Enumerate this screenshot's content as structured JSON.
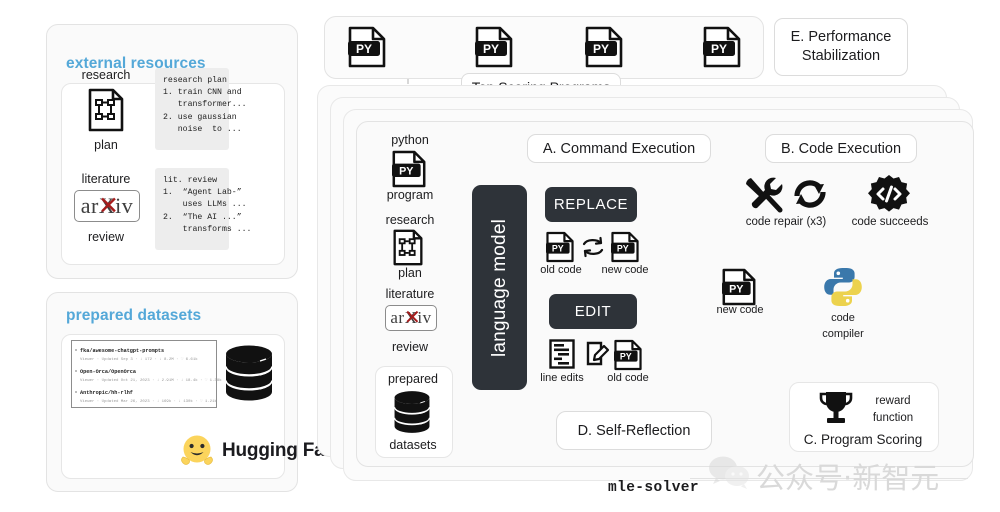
{
  "external_resources": {
    "title": "external resources",
    "research_plan": {
      "top_label": "research",
      "bottom_label": "plan",
      "icon": "flowchart-document-icon"
    },
    "research_plan_code": "research plan\n1. train CNN and\n   transformer...\n2. use gaussian\n   noise  to ...",
    "literature_review": {
      "top_label": "literature",
      "bottom_label": "review",
      "icon": "arxiv-logo",
      "logo_text": "arXiv"
    },
    "literature_code": "lit. review\n1.  “Agent Lab-”\n    uses LLMs ...\n2.  “The AI ...”\n    transforms ..."
  },
  "prepared_datasets": {
    "title": "prepared datasets",
    "database_icon": "database-stack-icon",
    "huggingface": {
      "wordmark": "Hugging Face",
      "icon": "hugging-face-emoji"
    },
    "rows": [
      {
        "name": "fka/awesome-chatgpt-prompts",
        "meta": "Viewer · Updated Sep 3 · ↓ 172 · ↓ 8.2M · ♡ 6.61k"
      },
      {
        "name": "Open-Orca/OpenOrca",
        "meta": "Viewer · Updated Oct 21, 2023 · ↓ 2.91M · ↓ 18.4k · ♡ 1.38k"
      },
      {
        "name": "Anthropic/hh-rlhf",
        "meta": "Viewer · Updated Mar 26, 2023 · ↓ 169k · ↓ 130k · ♡ 1.21k"
      }
    ]
  },
  "top_banner": {
    "caption": "Top Scoring Programs",
    "program_count": 4,
    "program_icon": "python-file-icon"
  },
  "performance_stabilization": {
    "line1": "E. Performance",
    "line2": "Stabilization"
  },
  "solver": {
    "caption": "mle-solver",
    "language_model": "language model",
    "inputs": [
      {
        "top": "python",
        "bottom": "program",
        "icon": "python-file-icon"
      },
      {
        "top": "research",
        "bottom": "plan",
        "icon": "flowchart-document-icon"
      },
      {
        "top": "literature",
        "bottom": "review",
        "icon": "arxiv-logo"
      },
      {
        "top": "prepared",
        "bottom": "datasets",
        "icon": "database-stack-icon"
      }
    ],
    "section_a": {
      "title": "A. Command Execution",
      "replace_label": "REPLACE",
      "replace_icons": [
        {
          "label": "old code",
          "icon": "python-file-icon"
        },
        {
          "label": "",
          "icon": "swap-arrows-icon"
        },
        {
          "label": "new code",
          "icon": "python-file-icon"
        }
      ],
      "edit_label": "EDIT",
      "edit_icons": [
        {
          "label": "line edits",
          "icon": "diff-lines-icon"
        },
        {
          "label": "",
          "icon": "pencil-square-icon"
        },
        {
          "label": "old code",
          "icon": "python-file-icon"
        }
      ]
    },
    "section_b": {
      "title": "B. Code Execution",
      "code_repair": {
        "label": "code repair (x3)",
        "icons": [
          "wrench-screwdriver-icon",
          "refresh-cycle-icon"
        ]
      },
      "code_succeeds": {
        "label": "code succeeds",
        "icon": "code-gear-icon"
      },
      "new_code": {
        "label": "new code",
        "icon": "python-file-icon"
      },
      "compiler": {
        "line1": "code",
        "line2": "compiler",
        "icon": "python-logo-icon"
      }
    },
    "section_c": {
      "title": "C. Program Scoring",
      "reward_line1": "reward",
      "reward_line2": "function",
      "icon": "trophy-icon"
    },
    "section_d": {
      "title": "D. Self-Reflection"
    }
  },
  "watermark": {
    "text": "公众号·新智元",
    "icon": "wechat-icon"
  },
  "colors": {
    "accent_blue": "#54a8d8",
    "dark_panel": "#2e3339",
    "reflect_arrow": "#e0a0a0",
    "score_arrow": "#a9cfc4",
    "card_bg": "#fafafa",
    "page_bg": "#ffffff"
  }
}
